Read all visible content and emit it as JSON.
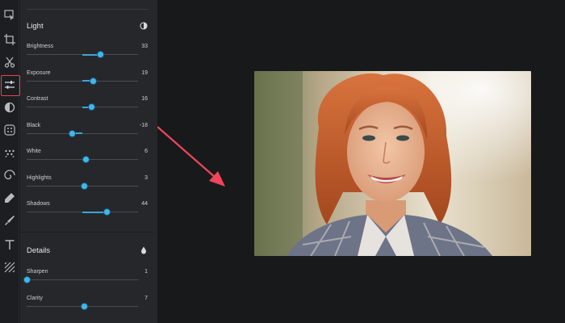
{
  "toolbar": {
    "tools": [
      {
        "name": "select-tool",
        "icon": "cursor-icon"
      },
      {
        "name": "crop-tool",
        "icon": "crop-icon"
      },
      {
        "name": "cut-tool",
        "icon": "scissors-icon"
      },
      {
        "name": "adjust-tool",
        "icon": "sliders-icon",
        "active": true
      },
      {
        "name": "filter-tool",
        "icon": "contrast-circle-icon"
      },
      {
        "name": "effects-tool",
        "icon": "dotted-square-icon"
      },
      {
        "name": "texture-tool",
        "icon": "dots-grid-icon"
      },
      {
        "name": "shape-tool",
        "icon": "spiral-icon"
      },
      {
        "name": "brush-tool",
        "icon": "eraser-icon"
      },
      {
        "name": "retouch-tool",
        "icon": "pen-nib-icon"
      },
      {
        "name": "text-tool",
        "icon": "text-t-icon"
      },
      {
        "name": "pattern-tool",
        "icon": "diagonal-lines-icon"
      }
    ],
    "active_color": "#e8434f"
  },
  "panel": {
    "light": {
      "title": "Light",
      "icon": "half-circle-icon",
      "sliders": [
        {
          "label": "Brightness",
          "value": "33",
          "fraction": 0.665
        },
        {
          "label": "Exposure",
          "value": "19",
          "fraction": 0.595
        },
        {
          "label": "Contrast",
          "value": "16",
          "fraction": 0.58
        },
        {
          "label": "Black",
          "value": "-18",
          "fraction": 0.41
        },
        {
          "label": "White",
          "value": "6",
          "fraction": 0.53
        },
        {
          "label": "Highlights",
          "value": "3",
          "fraction": 0.515
        },
        {
          "label": "Shadows",
          "value": "44",
          "fraction": 0.72
        }
      ]
    },
    "details": {
      "title": "Details",
      "icon": "droplet-icon",
      "sliders": [
        {
          "label": "Sharpen",
          "value": "1",
          "fraction": 0.0
        },
        {
          "label": "Clarity",
          "value": "7",
          "fraction": 0.52
        }
      ]
    },
    "accent_color": "#3aa5d8"
  },
  "canvas": {
    "photo_subject": "smiling red-haired woman in plaid shirt",
    "annotation": "red-arrow"
  }
}
